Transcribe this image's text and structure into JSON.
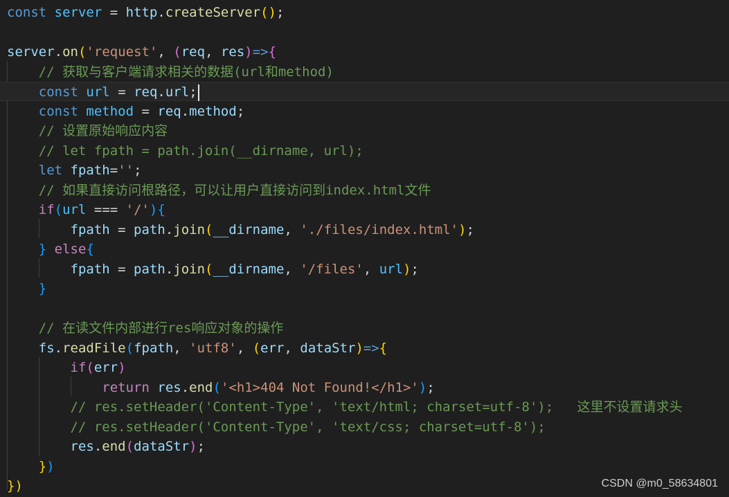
{
  "colors": {
    "background": "#1f1f1f",
    "keyword": "#569cd6",
    "control_keyword": "#c586c0",
    "variable": "#4fc1ff",
    "property": "#9cdcfe",
    "function": "#dcdcaa",
    "string": "#ce9178",
    "comment": "#6a9955",
    "bracket_level1": "#ffd700",
    "bracket_level2": "#da70d6",
    "bracket_level3": "#179fff"
  },
  "code_lines": [
    [
      [
        "kw",
        "const"
      ],
      [
        "op",
        " "
      ],
      [
        "var",
        "server"
      ],
      [
        "op",
        " = "
      ],
      [
        "prop",
        "http"
      ],
      [
        "op",
        "."
      ],
      [
        "fn",
        "createServer"
      ],
      [
        "p1",
        "()"
      ],
      [
        "op",
        ";"
      ]
    ],
    [],
    [
      [
        "prop",
        "server"
      ],
      [
        "op",
        "."
      ],
      [
        "fn",
        "on"
      ],
      [
        "p1",
        "("
      ],
      [
        "str",
        "'request'"
      ],
      [
        "op",
        ", "
      ],
      [
        "p2",
        "("
      ],
      [
        "prop",
        "req"
      ],
      [
        "op",
        ", "
      ],
      [
        "prop",
        "res"
      ],
      [
        "p2",
        ")"
      ],
      [
        "kw",
        "=>"
      ],
      [
        "p2",
        "{"
      ]
    ],
    [
      [
        "op",
        "    "
      ],
      [
        "cmt",
        "// 获取与客户端请求相关的数据(url和method)"
      ]
    ],
    [
      [
        "op",
        "    "
      ],
      [
        "kw",
        "const"
      ],
      [
        "op",
        " "
      ],
      [
        "var",
        "url"
      ],
      [
        "op",
        " = "
      ],
      [
        "prop",
        "req"
      ],
      [
        "op",
        "."
      ],
      [
        "prop",
        "url"
      ],
      [
        "op",
        ";"
      ],
      [
        "cursor",
        ""
      ]
    ],
    [
      [
        "op",
        "    "
      ],
      [
        "kw",
        "const"
      ],
      [
        "op",
        " "
      ],
      [
        "var",
        "method"
      ],
      [
        "op",
        " = "
      ],
      [
        "prop",
        "req"
      ],
      [
        "op",
        "."
      ],
      [
        "prop",
        "method"
      ],
      [
        "op",
        ";"
      ]
    ],
    [
      [
        "op",
        "    "
      ],
      [
        "cmt",
        "// 设置原始响应内容"
      ]
    ],
    [
      [
        "op",
        "    "
      ],
      [
        "cmt",
        "// let fpath = path.join(__dirname, url);"
      ]
    ],
    [
      [
        "op",
        "    "
      ],
      [
        "kw",
        "let"
      ],
      [
        "op",
        " "
      ],
      [
        "prop",
        "fpath"
      ],
      [
        "op",
        "="
      ],
      [
        "str",
        "''"
      ],
      [
        "op",
        ";"
      ]
    ],
    [
      [
        "op",
        "    "
      ],
      [
        "cmt",
        "// 如果直接访问根路径，可以让用户直接访问到index.html文件"
      ]
    ],
    [
      [
        "op",
        "    "
      ],
      [
        "kw2",
        "if"
      ],
      [
        "p3",
        "("
      ],
      [
        "var",
        "url"
      ],
      [
        "op",
        " === "
      ],
      [
        "str",
        "'/'"
      ],
      [
        "p3",
        ")"
      ],
      [
        "p3",
        "{"
      ]
    ],
    [
      [
        "op",
        "        "
      ],
      [
        "prop",
        "fpath"
      ],
      [
        "op",
        " = "
      ],
      [
        "prop",
        "path"
      ],
      [
        "op",
        "."
      ],
      [
        "fn",
        "join"
      ],
      [
        "p1",
        "("
      ],
      [
        "prop",
        "__dirname"
      ],
      [
        "op",
        ", "
      ],
      [
        "str",
        "'./files/index.html'"
      ],
      [
        "p1",
        ")"
      ],
      [
        "op",
        ";"
      ]
    ],
    [
      [
        "op",
        "    "
      ],
      [
        "p3",
        "}"
      ],
      [
        "op",
        " "
      ],
      [
        "kw2",
        "else"
      ],
      [
        "p3",
        "{"
      ]
    ],
    [
      [
        "op",
        "        "
      ],
      [
        "prop",
        "fpath"
      ],
      [
        "op",
        " = "
      ],
      [
        "prop",
        "path"
      ],
      [
        "op",
        "."
      ],
      [
        "fn",
        "join"
      ],
      [
        "p1",
        "("
      ],
      [
        "prop",
        "__dirname"
      ],
      [
        "op",
        ", "
      ],
      [
        "str",
        "'/files'"
      ],
      [
        "op",
        ", "
      ],
      [
        "var",
        "url"
      ],
      [
        "p1",
        ")"
      ],
      [
        "op",
        ";"
      ]
    ],
    [
      [
        "op",
        "    "
      ],
      [
        "p3",
        "}"
      ]
    ],
    [],
    [
      [
        "op",
        "    "
      ],
      [
        "cmt",
        "// 在读文件内部进行res响应对象的操作"
      ]
    ],
    [
      [
        "op",
        "    "
      ],
      [
        "prop",
        "fs"
      ],
      [
        "op",
        "."
      ],
      [
        "fn",
        "readFile"
      ],
      [
        "p3",
        "("
      ],
      [
        "prop",
        "fpath"
      ],
      [
        "op",
        ", "
      ],
      [
        "str",
        "'utf8'"
      ],
      [
        "op",
        ", "
      ],
      [
        "p1",
        "("
      ],
      [
        "prop",
        "err"
      ],
      [
        "op",
        ", "
      ],
      [
        "prop",
        "dataStr"
      ],
      [
        "p1",
        ")"
      ],
      [
        "kw",
        "=>"
      ],
      [
        "p1",
        "{"
      ]
    ],
    [
      [
        "op",
        "        "
      ],
      [
        "kw2",
        "if"
      ],
      [
        "p2",
        "("
      ],
      [
        "prop",
        "err"
      ],
      [
        "p2",
        ")"
      ]
    ],
    [
      [
        "op",
        "            "
      ],
      [
        "kw2",
        "return"
      ],
      [
        "op",
        " "
      ],
      [
        "prop",
        "res"
      ],
      [
        "op",
        "."
      ],
      [
        "fn",
        "end"
      ],
      [
        "p3",
        "("
      ],
      [
        "str",
        "'<h1>404 Not Found!</h1>'"
      ],
      [
        "p3",
        ")"
      ],
      [
        "op",
        ";"
      ]
    ],
    [
      [
        "op",
        "        "
      ],
      [
        "cmt",
        "// res.setHeader('Content-Type', 'text/html; charset=utf-8');   这里不设置请求头"
      ]
    ],
    [
      [
        "op",
        "        "
      ],
      [
        "cmt",
        "// res.setHeader('Content-Type', 'text/css; charset=utf-8');"
      ]
    ],
    [
      [
        "op",
        "        "
      ],
      [
        "prop",
        "res"
      ],
      [
        "op",
        "."
      ],
      [
        "fn",
        "end"
      ],
      [
        "p2",
        "("
      ],
      [
        "prop",
        "dataStr"
      ],
      [
        "p2",
        ")"
      ],
      [
        "op",
        ";"
      ]
    ],
    [
      [
        "op",
        "    "
      ],
      [
        "p1",
        "}"
      ],
      [
        "p3",
        ")"
      ]
    ],
    [
      [
        "p1",
        "}"
      ],
      [
        "p1",
        ")"
      ]
    ]
  ],
  "watermark": "CSDN @m0_58634801"
}
